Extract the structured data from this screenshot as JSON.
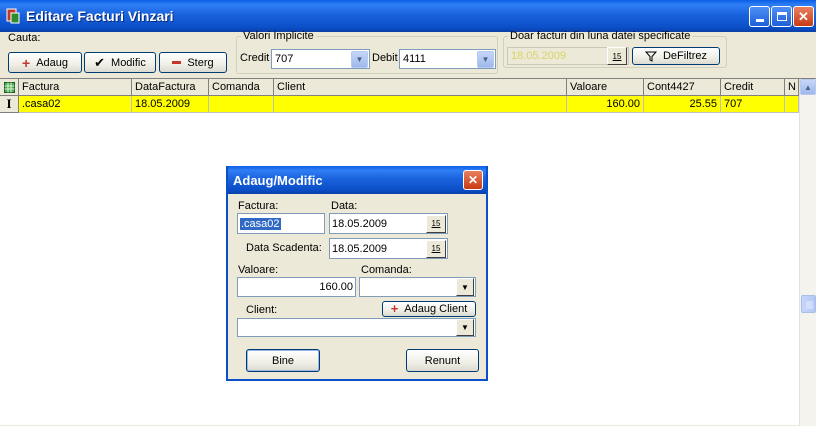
{
  "window": {
    "title": "Editare Facturi Vinzari"
  },
  "toolbar": {
    "search_label": "Cauta:",
    "add_label": "Adaug",
    "edit_label": "Modific",
    "delete_label": "Sterg",
    "defaults_group": "Valori Implicite",
    "credit_label": "Credit",
    "credit_value": "707",
    "debit_label": "Debit",
    "debit_value": "4111",
    "filter_group": "Doar facturi din luna datei specificate",
    "filter_date": "18.05.2009",
    "unfilter_label": "DeFiltrez"
  },
  "grid": {
    "columns": [
      "Factura",
      "DataFactura",
      "Comanda",
      "Client",
      "Valoare",
      "Cont4427",
      "Credit",
      "N"
    ],
    "rows": [
      {
        "indicator": "I",
        "factura": ".casa02",
        "data_factura": "18.05.2009",
        "comanda": "",
        "client": "",
        "valoare": "160.00",
        "cont4427": "25.55",
        "credit": "707"
      }
    ]
  },
  "dialog": {
    "title": "Adaug/Modific",
    "factura_label": "Factura:",
    "factura_value": ".casa02",
    "data_label": "Data:",
    "data_value": "18.05.2009",
    "scadenta_label": "Data Scadenta:",
    "scadenta_value": "18.05.2009",
    "valoare_label": "Valoare:",
    "valoare_value": "160.00",
    "comanda_label": "Comanda:",
    "comanda_value": "",
    "client_label": "Client:",
    "client_value": "",
    "add_client_label": "Adaug Client",
    "ok_label": "Bine",
    "cancel_label": "Renunt",
    "calendar_glyph": "15"
  },
  "colors": {
    "row_highlight": "#ffff00",
    "title_bar": "#0b4fc8",
    "plus_icon": "#c0392b",
    "minus_icon": "#c0392b"
  }
}
